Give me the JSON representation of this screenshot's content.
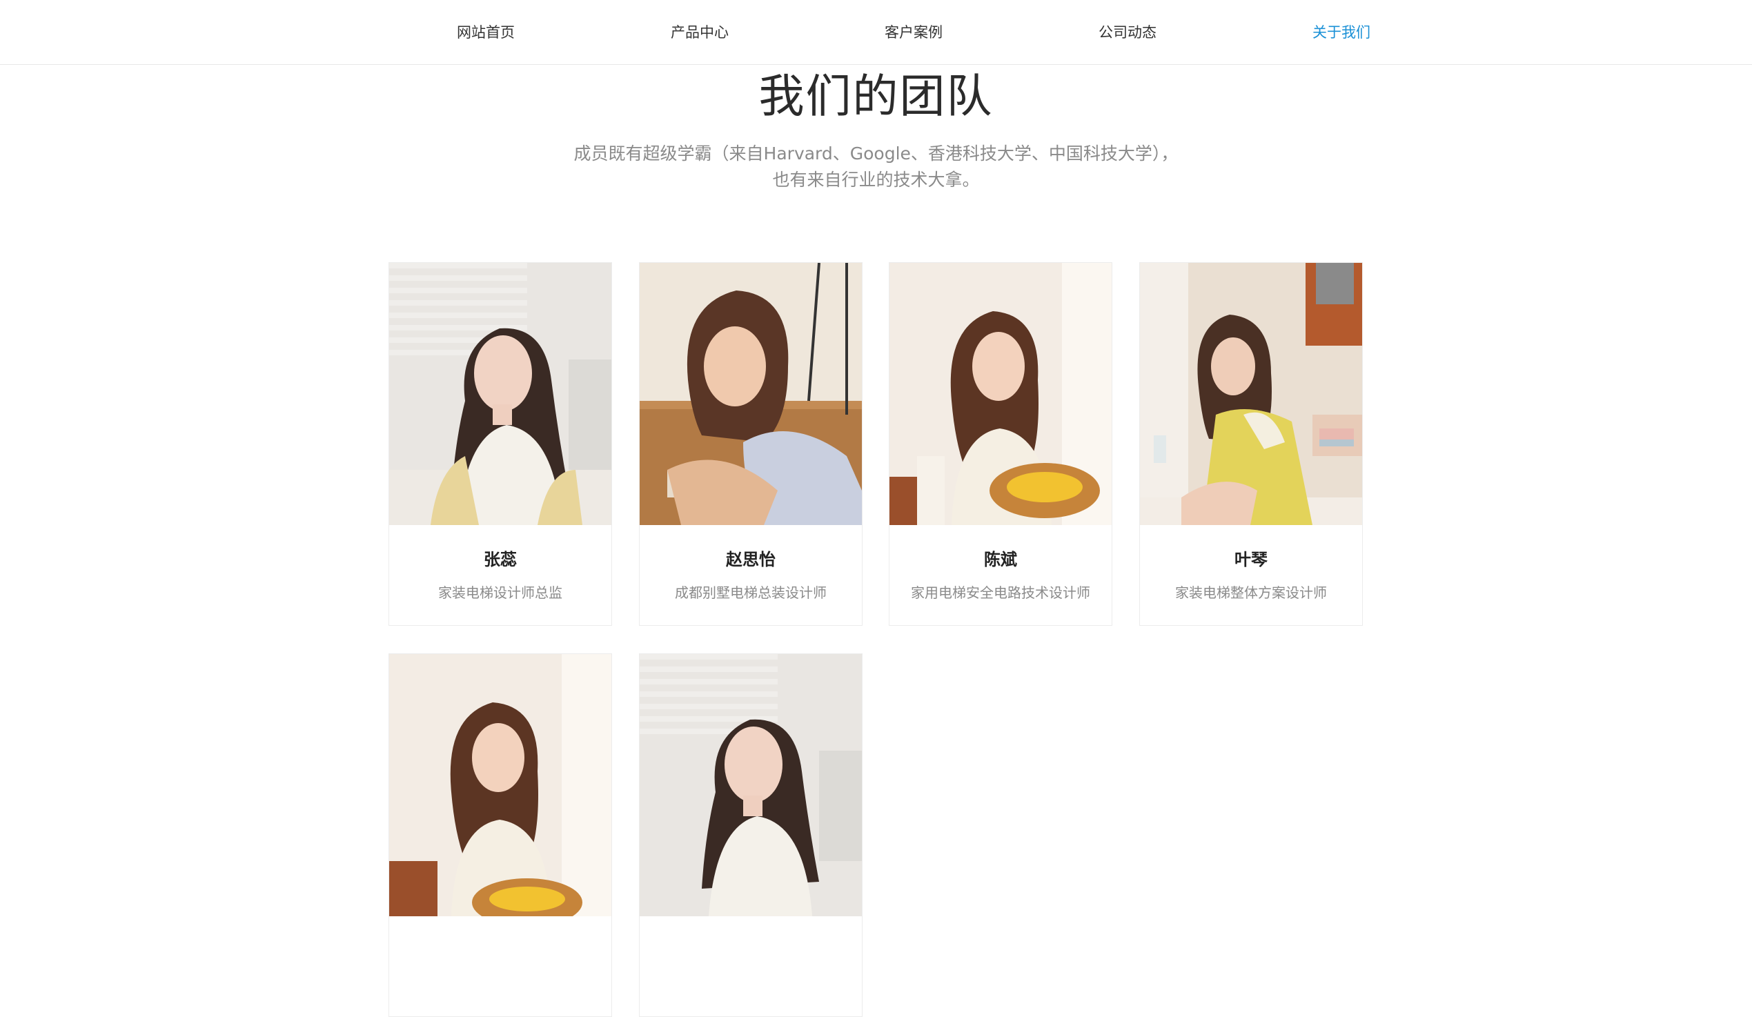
{
  "nav": {
    "items": [
      {
        "label": "网站首页"
      },
      {
        "label": "产品中心"
      },
      {
        "label": "客户案例"
      },
      {
        "label": "公司动态"
      },
      {
        "label": "关于我们"
      }
    ],
    "active_color": "#1a90d6"
  },
  "team": {
    "title": "我们的团队",
    "description_line1": "成员既有超级学霸（来自Harvard、Google、香港科技大学、中国科技大学），",
    "description_line2": "也有来自行业的技术大拿。",
    "members": [
      {
        "name": "张蕊",
        "role": "家装电梯设计师总监"
      },
      {
        "name": "赵思怡",
        "role": "成都别墅电梯总装设计师"
      },
      {
        "name": "陈斌",
        "role": "家用电梯安全电路技术设计师"
      },
      {
        "name": "叶琴",
        "role": "家装电梯整体方案设计师"
      },
      {
        "name": "",
        "role": ""
      },
      {
        "name": "",
        "role": ""
      }
    ]
  }
}
